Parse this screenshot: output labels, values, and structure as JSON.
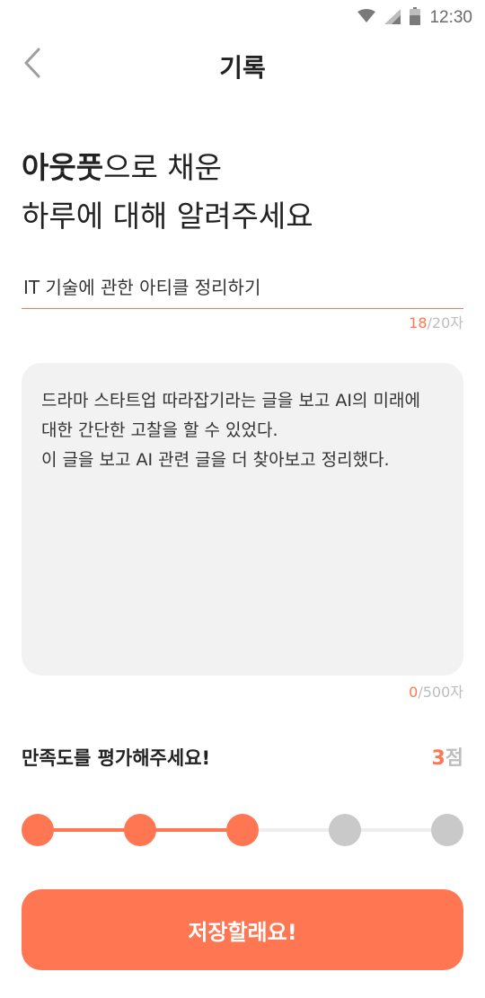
{
  "status_bar": {
    "time": "12:30",
    "icons": [
      "wifi-icon",
      "signal-icon",
      "battery-icon"
    ]
  },
  "app_bar": {
    "back_icon": "chevron-left-icon",
    "title": "기록"
  },
  "headline": {
    "bold": "아웃풋",
    "rest_line1": "으로 채운",
    "line2": "하루에 대해 알려주세요"
  },
  "title_field": {
    "value": "IT 기술에 관한 아티클 정리하기",
    "count": "18",
    "max": "/20자"
  },
  "content_field": {
    "value": "드라마 스타트업 따라잡기라는 글을 보고 AI의 미래에 대한 간단한 고찰을 할 수 있었다.\n이 글을 보고 AI 관련 글을 더 찾아보고 정리했다.",
    "count": "0",
    "max": "/500자"
  },
  "rating": {
    "label": "만족도를 평가해주세요!",
    "score": "3",
    "unit": "점",
    "value": 3,
    "max": 5
  },
  "save_button": {
    "label": "저장할래요!"
  },
  "colors": {
    "accent": "#ff7752",
    "inactive": "#c9c9c9",
    "text_box_bg": "#f2f2f2"
  }
}
